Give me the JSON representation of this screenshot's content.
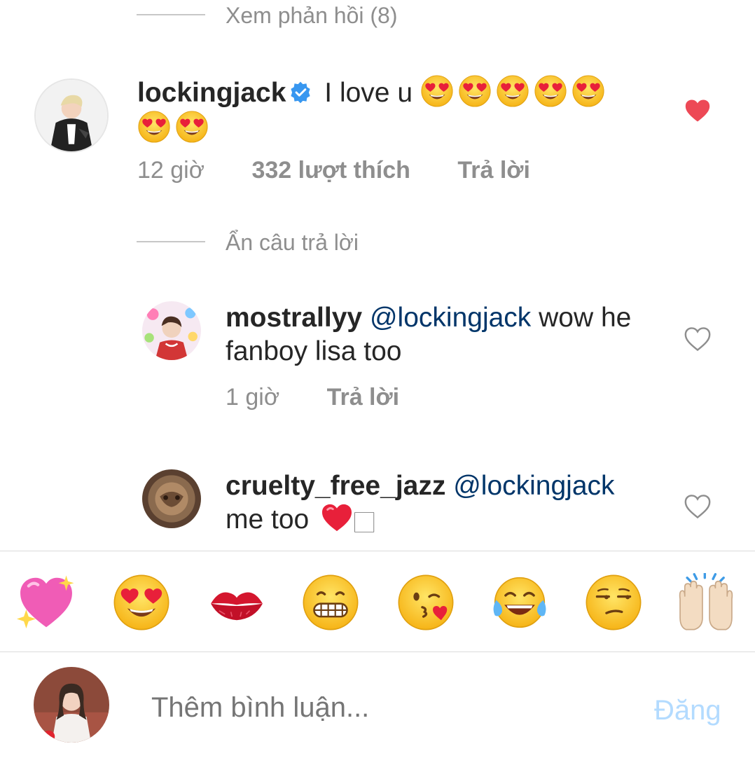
{
  "thread": {
    "view_replies_label": "Xem phản hồi (8)",
    "hide_replies_label": "Ẩn câu trả lời"
  },
  "main_comment": {
    "username": "lockingjack",
    "text": "I love u",
    "emoji_count": 7,
    "time": "12 giờ",
    "likes": "332 lượt thích",
    "reply_label": "Trả lời",
    "liked": true
  },
  "replies": [
    {
      "username": "mostrallyy",
      "mention": "@lockingjack",
      "text_line1": " wow he",
      "text_line2": "fanboy lisa too",
      "time": "1 giờ",
      "reply_label": "Trả lời",
      "liked": false
    },
    {
      "username": "cruelty_free_jazz",
      "mention": "@lockingjack",
      "text_line2": "me too",
      "trailing_glyph": "🏻",
      "liked": false
    }
  ],
  "emoji_tray": [
    {
      "icon": "sparkling-heart-icon"
    },
    {
      "icon": "heart-eyes-icon"
    },
    {
      "icon": "kiss-mark-icon"
    },
    {
      "icon": "grimacing-icon"
    },
    {
      "icon": "face-blowing-kiss-icon"
    },
    {
      "icon": "tears-of-joy-icon"
    },
    {
      "icon": "unamused-face-icon"
    },
    {
      "icon": "raising-hands-icon"
    }
  ],
  "composer": {
    "placeholder": "Thêm bình luận...",
    "post_label": "Đăng"
  },
  "colors": {
    "liked_heart": "#ed4956",
    "mention": "#003569",
    "post_button_disabled": "#b3dbff",
    "verified_badge": "#3897f0"
  }
}
